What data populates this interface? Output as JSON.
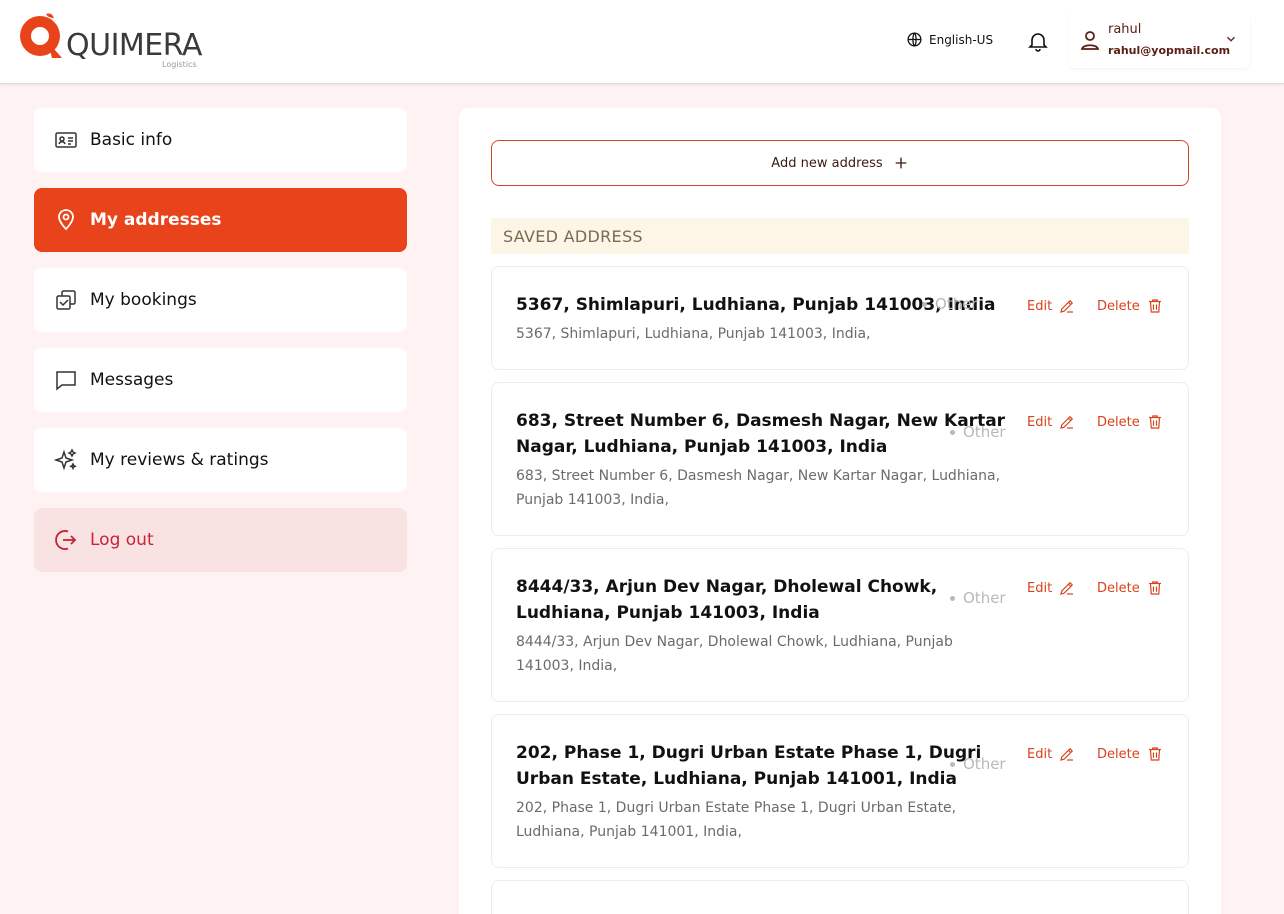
{
  "brand": {
    "name": "QUIMERA",
    "tagline": "Logistics",
    "accent": "#e8431a"
  },
  "header": {
    "language": "English-US",
    "user": {
      "name": "rahul",
      "email": "rahul@yopmail.com"
    }
  },
  "sidebar": {
    "items": [
      {
        "label": "Basic info",
        "icon": "id-card-icon",
        "active": false
      },
      {
        "label": "My addresses",
        "icon": "map-pin-icon",
        "active": true
      },
      {
        "label": "My bookings",
        "icon": "bookings-icon",
        "active": false
      },
      {
        "label": "Messages",
        "icon": "message-icon",
        "active": false
      },
      {
        "label": "My reviews & ratings",
        "icon": "sparkles-icon",
        "active": false
      },
      {
        "label": "Log out",
        "icon": "logout-icon",
        "active": false
      }
    ]
  },
  "main": {
    "add_button_label": "Add new address",
    "saved_header": "SAVED ADDRESS",
    "edit_label": "Edit",
    "delete_label": "Delete",
    "addresses": [
      {
        "title_lines": [
          "5367, Shimlapuri, Ludhiana, Punjab 141003, India"
        ],
        "sub_lines": [
          "5367, Shimlapuri, Ludhiana, Punjab 141003, India,"
        ],
        "tag": "Other"
      },
      {
        "title_lines": [
          "683, Street Number 6, Dasmesh Nagar, New Kartar",
          "Nagar, Ludhiana, Punjab 141003, India"
        ],
        "sub_lines": [
          "683, Street Number 6, Dasmesh Nagar, New Kartar Nagar, Ludhiana,",
          "Punjab 141003, India,"
        ],
        "tag": "Other"
      },
      {
        "title_lines": [
          "8444/33, Arjun Dev Nagar, Dholewal Chowk,",
          "Ludhiana, Punjab 141003, India"
        ],
        "sub_lines": [
          "8444/33, Arjun Dev Nagar, Dholewal Chowk, Ludhiana, Punjab",
          "141003, India,"
        ],
        "tag": "Other"
      },
      {
        "title_lines": [
          "202, Phase 1, Dugri Urban Estate Phase 1, Dugri",
          "Urban Estate, Ludhiana, Punjab 141001, India"
        ],
        "sub_lines": [
          "202, Phase 1, Dugri Urban Estate Phase 1, Dugri Urban Estate,",
          "Ludhiana, Punjab 141001, India,"
        ],
        "tag": "Other"
      }
    ]
  }
}
